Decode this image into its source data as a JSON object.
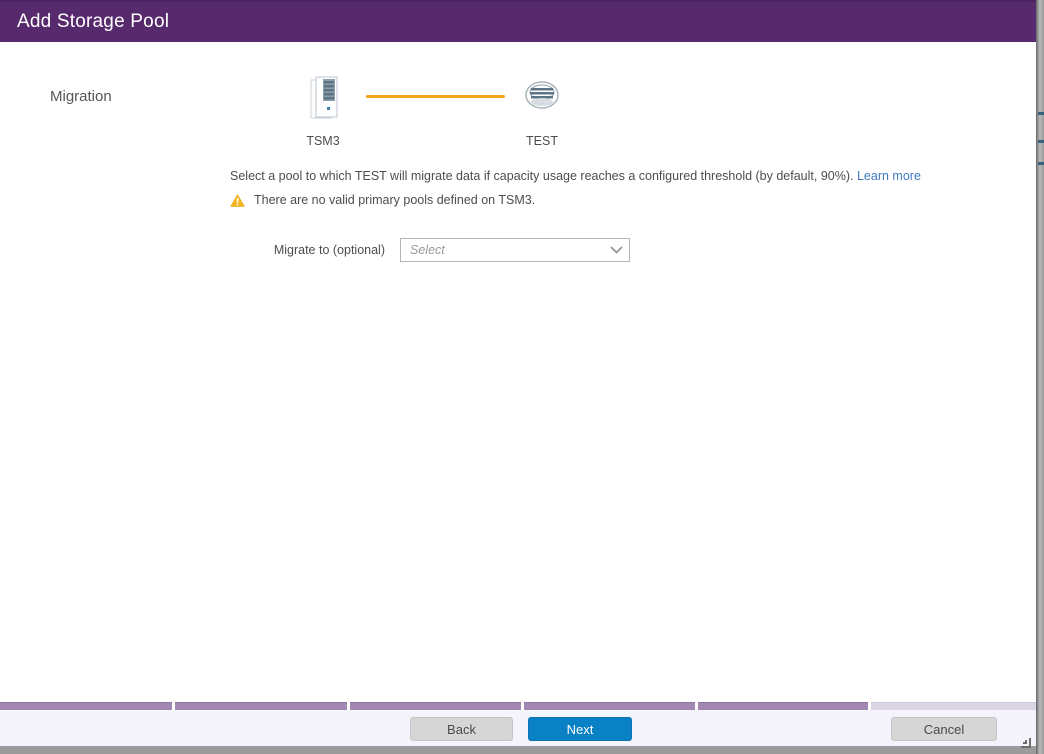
{
  "dialog": {
    "title": "Add Storage Pool"
  },
  "step": {
    "label": "Migration"
  },
  "diagram": {
    "source": {
      "name": "TSM3",
      "icon": "server-icon"
    },
    "target": {
      "name": "TEST",
      "icon": "storage-pool-icon"
    },
    "connector_color": "#f2a51a"
  },
  "description": {
    "text": "Select a pool to which TEST will migrate data if capacity usage reaches a configured threshold (by default, 90%).",
    "link_label": "Learn more"
  },
  "warning": {
    "icon": "warning-icon",
    "text": "There are no valid primary pools defined on TSM3."
  },
  "form": {
    "migrate_label": "Migrate to (optional)",
    "select_placeholder": "Select",
    "chevron": "⌄"
  },
  "footer": {
    "back_label": "Back",
    "next_label": "Next",
    "cancel_label": "Cancel"
  },
  "colors": {
    "header_bg": "#572a6e",
    "primary_blue": "#0a80c5",
    "link_blue": "#4178be",
    "accent_orange": "#f2a51a",
    "warning_yellow": "#f5b51c",
    "footer_bg": "#f5f4fc",
    "bg_table_header_purple": "#a287b2"
  }
}
